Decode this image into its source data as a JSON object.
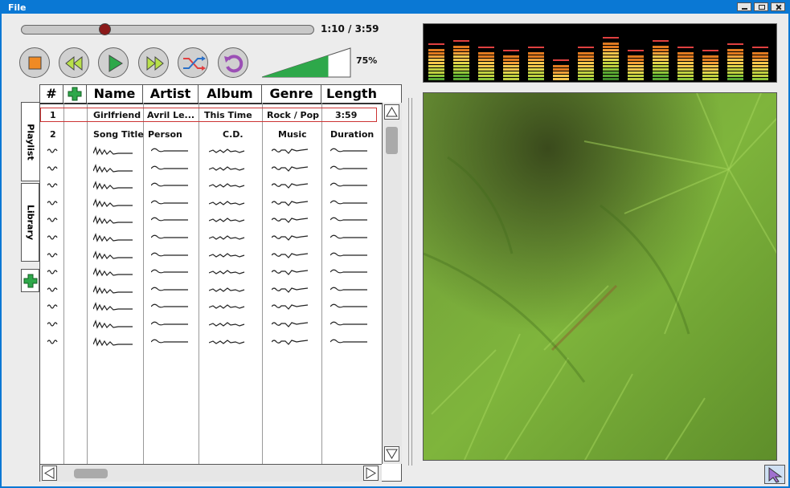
{
  "window": {
    "menu": "File"
  },
  "transport": {
    "time_display": "1:10 / 3:59",
    "progress_fraction": 0.29,
    "volume_label": "75%",
    "volume_fraction": 0.75,
    "buttons": [
      "stop-icon",
      "rewind-icon",
      "play-icon",
      "fast-forward-icon",
      "shuffle-icon",
      "repeat-icon"
    ]
  },
  "playlist": {
    "headers": {
      "num": "#",
      "name": "Name",
      "artist": "Artist",
      "album": "Album",
      "genre": "Genre",
      "length": "Length"
    },
    "rows": [
      {
        "num": "1",
        "name": "Girlfriend",
        "artist": "Avril Le...",
        "album": "This Time",
        "genre": "Rock / Pop",
        "length": "3:59"
      },
      {
        "num": "2",
        "name": "Song Title",
        "artist": "Person",
        "album": "C.D.",
        "genre": "Music",
        "length": "Duration"
      }
    ],
    "placeholder_row_count": 12
  },
  "tabs": {
    "playlist": "Playlist",
    "library": "Library"
  },
  "colors": {
    "accent": "#0a78d4",
    "play_green": "#2ea84a",
    "stop_orange": "#f08a24",
    "shuffle_red": "#e04040",
    "repeat_purple": "#9b4fb5",
    "selected_row_border": "#cc3333"
  }
}
